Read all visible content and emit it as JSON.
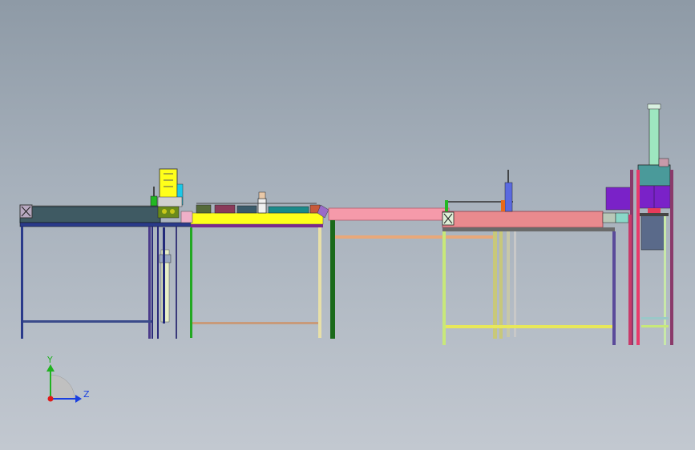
{
  "triad": {
    "y_label": "Y",
    "z_label": "Z",
    "colors": {
      "y": "#1fb31f",
      "z": "#1a3fe0",
      "origin": "#e01a1a"
    }
  },
  "colors": {
    "background_top": "#8e9aa6",
    "background_bottom": "#c2c8d0",
    "conveyor_belt": "#3f5a63",
    "assembly_table": "#ffff1a",
    "pink_table": "#f59aaa",
    "salmon_table": "#e98a8e",
    "purple_bins": "#7a22c8",
    "mint_column": "#9ee6c0"
  }
}
